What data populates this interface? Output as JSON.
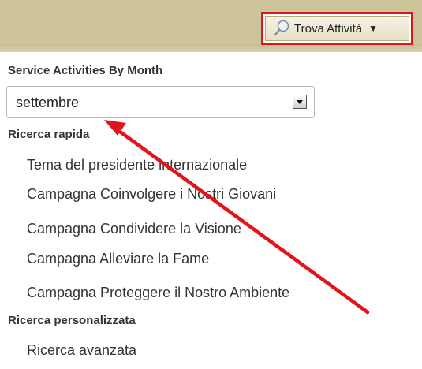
{
  "header": {
    "find_activities_label": "Trova Attività"
  },
  "month_filter": {
    "title": "Service Activities By Month",
    "selected": "settembre"
  },
  "quick_search": {
    "title": "Ricerca rapida",
    "items": [
      "Tema del presidente internazionale",
      "Campagna Coinvolgere i Nostri Giovani",
      "Campagna Condividere la Visione",
      "Campagna Alleviare la Fame",
      "Campagna Proteggere il Nostro Ambiente"
    ]
  },
  "custom_search": {
    "title": "Ricerca personalizzata",
    "items": [
      "Ricerca avanzata"
    ]
  },
  "colors": {
    "topbar": "#cdc49a",
    "highlight": "#e2141b",
    "annotation_arrow": "#e2141b"
  }
}
